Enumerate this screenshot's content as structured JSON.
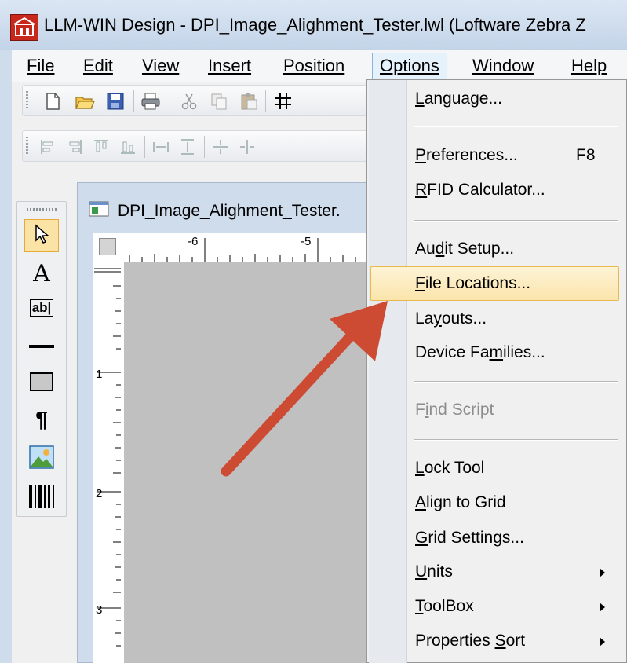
{
  "window": {
    "title": "LLM-WIN Design - DPI_Image_Alighment_Tester.lwl (Loftware Zebra Z"
  },
  "menubar": {
    "items": [
      "File",
      "Edit",
      "View",
      "Insert",
      "Position",
      "Options",
      "Window",
      "Help"
    ],
    "active": "Options"
  },
  "document": {
    "title": "DPI_Image_Alighment_Tester."
  },
  "rulers": {
    "horizontal_labels": [
      "-6",
      "-5"
    ],
    "vertical_labels": [
      "1",
      "2",
      "3"
    ]
  },
  "options_menu": {
    "items": [
      {
        "label": "Language...",
        "accel": "L",
        "shortcut": "",
        "submenu": false,
        "disabled": false
      },
      {
        "label": "Preferences...",
        "accel": "P",
        "shortcut": "F8",
        "submenu": false,
        "disabled": false
      },
      {
        "label": "RFID Calculator...",
        "accel": "R",
        "shortcut": "",
        "submenu": false,
        "disabled": false
      },
      {
        "label": "Audit Setup...",
        "accel": "d",
        "shortcut": "",
        "submenu": false,
        "disabled": false
      },
      {
        "label": "File Locations...",
        "accel": "F",
        "shortcut": "",
        "submenu": false,
        "disabled": false,
        "highlighted": true
      },
      {
        "label": "Layouts...",
        "accel": "y",
        "shortcut": "",
        "submenu": false,
        "disabled": false
      },
      {
        "label": "Device Families...",
        "accel": "m",
        "shortcut": "",
        "submenu": false,
        "disabled": false
      },
      {
        "label": "Find Script",
        "accel": "i",
        "shortcut": "",
        "submenu": false,
        "disabled": true
      },
      {
        "label": "Lock Tool",
        "accel": "L",
        "shortcut": "",
        "submenu": false,
        "disabled": false
      },
      {
        "label": "Align to Grid",
        "accel": "A",
        "shortcut": "",
        "submenu": false,
        "disabled": false
      },
      {
        "label": "Grid Settings...",
        "accel": "G",
        "shortcut": "",
        "submenu": false,
        "disabled": false
      },
      {
        "label": "Units",
        "accel": "U",
        "shortcut": "",
        "submenu": true,
        "disabled": false
      },
      {
        "label": "ToolBox",
        "accel": "T",
        "shortcut": "",
        "submenu": true,
        "disabled": false
      },
      {
        "label": "Properties Sort",
        "accel": "S",
        "shortcut": "",
        "submenu": true,
        "disabled": false
      }
    ]
  },
  "toolbox": {
    "tools": [
      "pointer-icon",
      "text-icon",
      "text-field-icon",
      "line-icon",
      "rectangle-icon",
      "paragraph-icon",
      "image-icon",
      "barcode-icon"
    ]
  },
  "annotation": {
    "arrow_color": "#cc4b32"
  },
  "colors": {
    "highlight": "#fbe5ab",
    "menu_active": "#e5f1fb",
    "canvas": "#c0c0c0"
  }
}
